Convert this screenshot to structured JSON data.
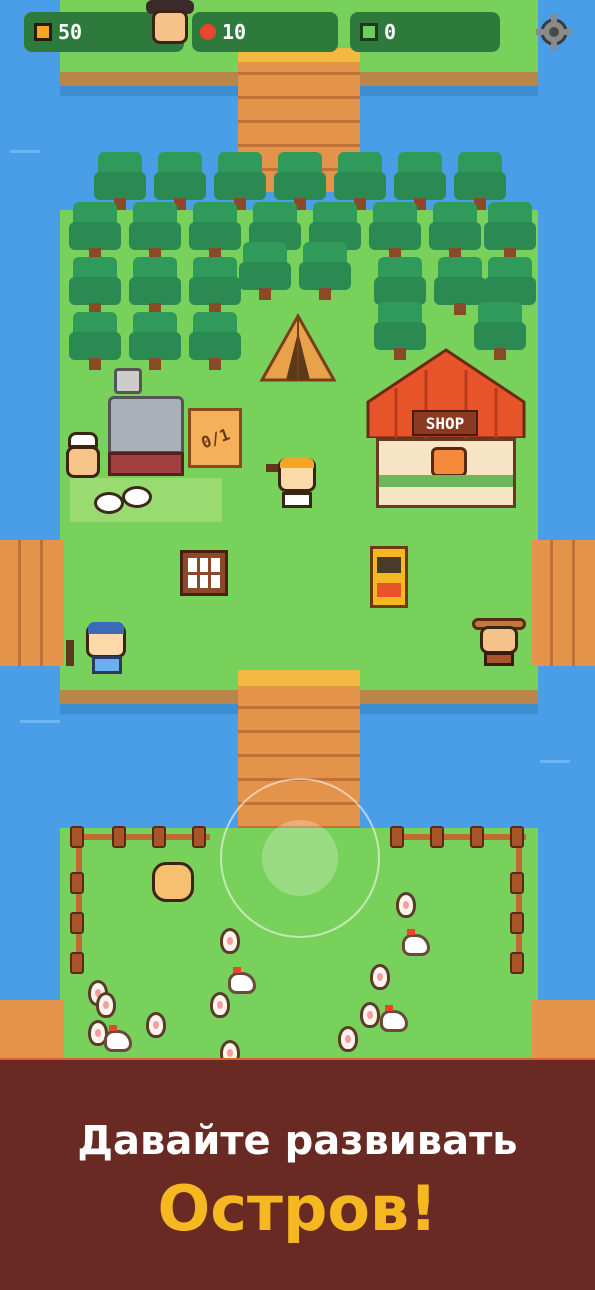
{
  "hud": {
    "coins": "50",
    "apples": "10",
    "gems": "0",
    "coin_icon": "coin-icon",
    "apple_icon": "apple-icon",
    "gem_icon": "gem-icon",
    "settings_icon": "gear-icon"
  },
  "buildings": {
    "shop_sign": "SHOP",
    "counter_label": "0/1"
  },
  "banner": {
    "line1": "Давайте развивать",
    "line2": "Остров!"
  },
  "colors": {
    "water": "#4a9ee8",
    "grass": "#78d15b",
    "tree": "#2f9a5a",
    "bridge": "#e3934a",
    "banner_bg": "#6a2a24",
    "banner_accent": "#f6b820"
  }
}
